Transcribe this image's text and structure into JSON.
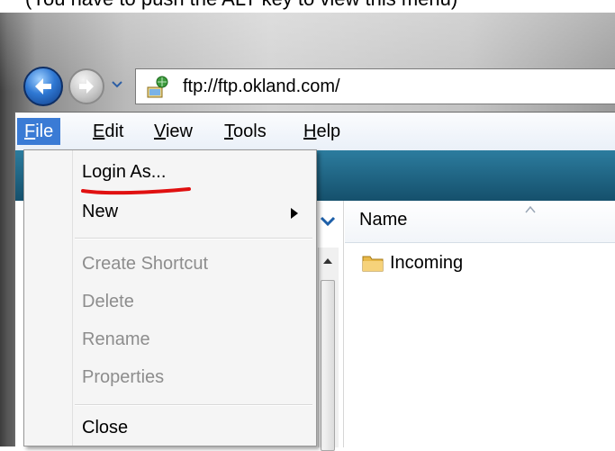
{
  "caption": "(You have to push the ALT key to view this menu)",
  "address_bar": {
    "url": "ftp://ftp.okland.com/"
  },
  "menubar": {
    "items": [
      {
        "label": "File",
        "underline": "F",
        "rest": "ile"
      },
      {
        "label": "Edit",
        "underline": "E",
        "rest": "dit"
      },
      {
        "label": "View",
        "underline": "V",
        "rest": "iew"
      },
      {
        "label": "Tools",
        "underline": "T",
        "rest": "ools"
      },
      {
        "label": "Help",
        "underline": "H",
        "rest": "elp"
      }
    ]
  },
  "file_menu": {
    "items": [
      {
        "label": "Login As...",
        "enabled": true
      },
      {
        "label": "New",
        "enabled": true,
        "submenu": true
      },
      {
        "label": "Create Shortcut",
        "enabled": false
      },
      {
        "label": "Delete",
        "enabled": false
      },
      {
        "label": "Rename",
        "enabled": false
      },
      {
        "label": "Properties",
        "enabled": false
      },
      {
        "label": "Close",
        "enabled": true
      }
    ]
  },
  "file_list": {
    "column_name": "Name",
    "rows": [
      {
        "name": "Incoming",
        "type": "folder"
      }
    ]
  },
  "colors": {
    "menu_highlight": "#3a7bd5",
    "toolbar": "#1f6a8a",
    "annotation_red": "#e01010",
    "disabled_text": "#8d8d8d"
  }
}
